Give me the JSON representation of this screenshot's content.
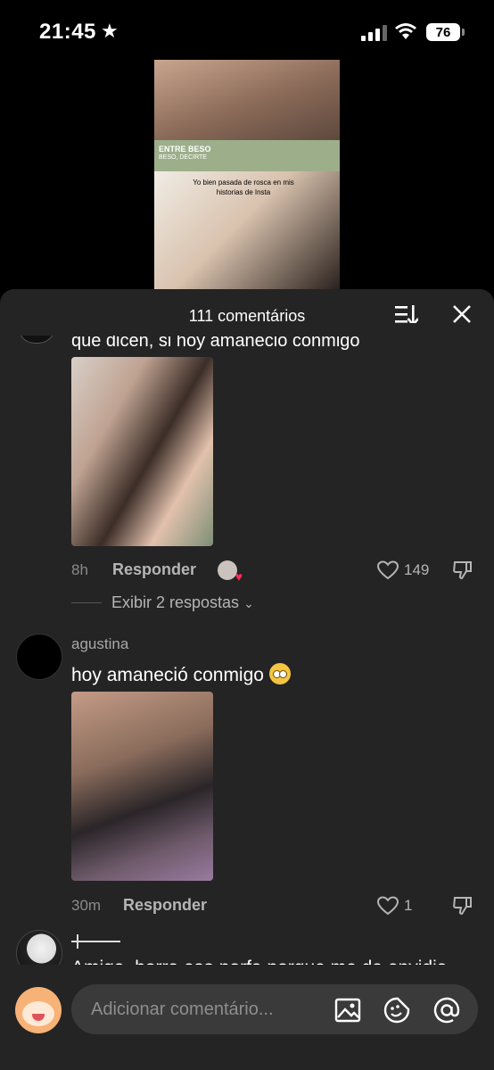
{
  "status_bar": {
    "time": "21:45",
    "battery": "76"
  },
  "video": {
    "caption_title": "ENTRE BESO",
    "caption_sub": "BESO, DECIRTE",
    "caption_text": "Yo bien pasada de rosca en mis historias de Insta"
  },
  "sheet": {
    "title": "111 comentários"
  },
  "comments": [
    {
      "text_clipped": "que dicen, si hoy amaneció conmigo",
      "time": "8h",
      "reply_label": "Responder",
      "likes": "149",
      "view_replies": "Exibir 2 respostas"
    },
    {
      "username": "agustina",
      "text": "hoy amaneció conmigo",
      "time": "30m",
      "reply_label": "Responder",
      "likes": "1"
    },
    {
      "text": "Amiga, borra eso porfa porque me da envidia"
    }
  ],
  "composer": {
    "placeholder": "Adicionar comentário..."
  }
}
